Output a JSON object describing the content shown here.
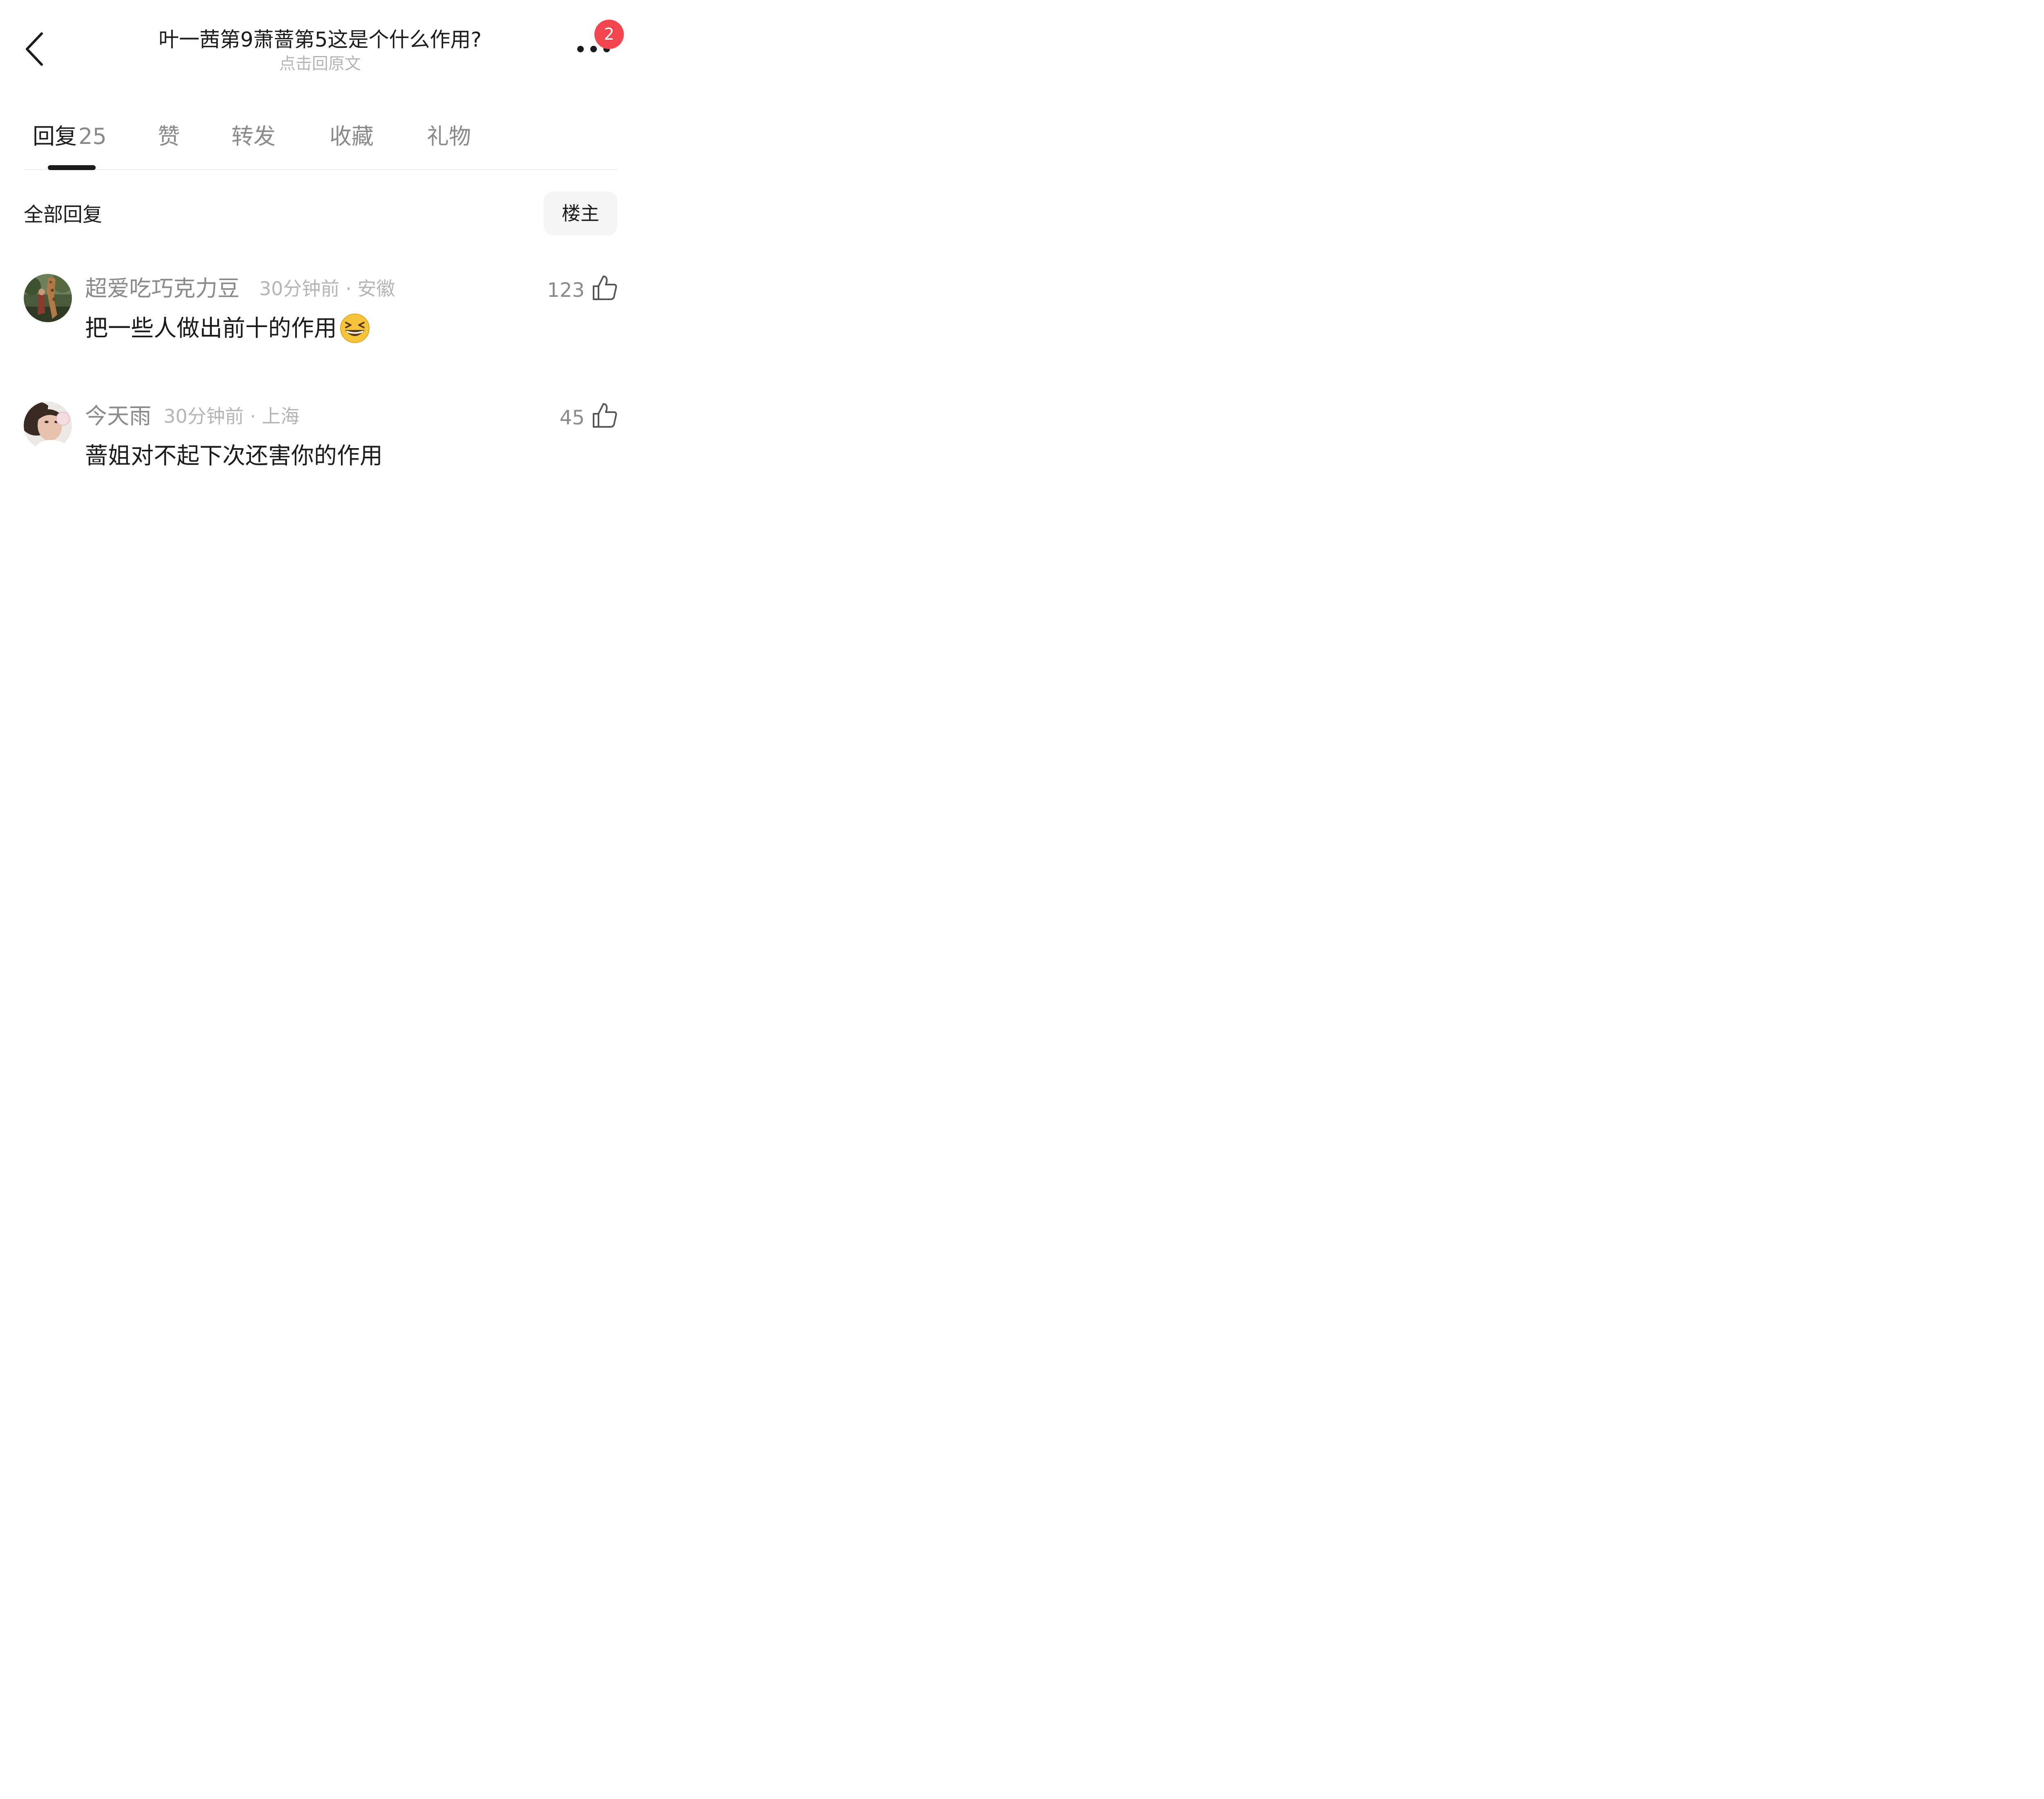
{
  "header": {
    "title": "叶一茜第9萧蔷第5这是个什么作用?",
    "subtitle": "点击回原文",
    "more_badge": "2"
  },
  "tabs": [
    {
      "label": "回复",
      "count": "25",
      "active": true
    },
    {
      "label": "赞"
    },
    {
      "label": "转发"
    },
    {
      "label": "收藏"
    },
    {
      "label": "礼物"
    }
  ],
  "section": {
    "title": "全部回复",
    "filter_label": "楼主"
  },
  "comments": [
    {
      "username": "超爱吃巧克力豆",
      "meta": "30分钟前 · 安徽",
      "text": "把一些人做出前十的作用",
      "emoji": "laughing-squint-emoji",
      "likes": "123"
    },
    {
      "username": "今天雨",
      "meta": "30分钟前 · 上海",
      "text": "蔷姐对不起下次还害你的作用",
      "likes": "45"
    }
  ],
  "colors": {
    "badge": "#f2454e",
    "text_primary": "#1b1b1b",
    "text_secondary": "#8a8a8a",
    "text_tertiary": "#b5b5b5"
  }
}
